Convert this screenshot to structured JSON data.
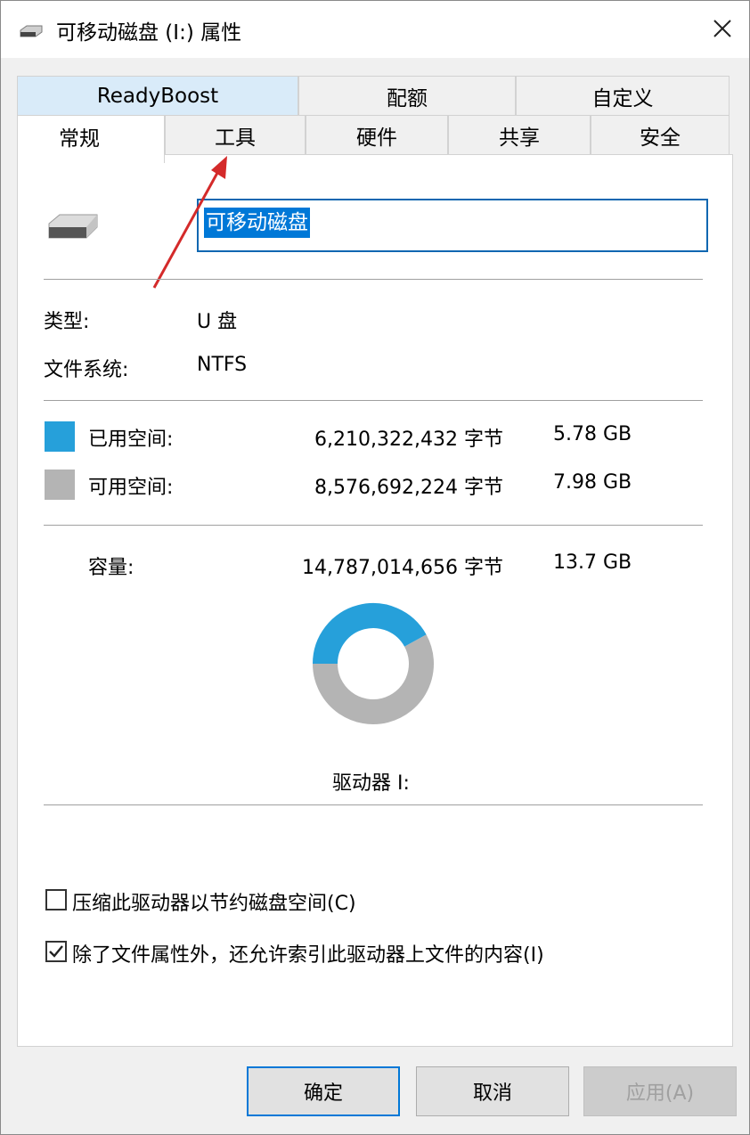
{
  "window": {
    "title": "可移动磁盘 (I:) 属性",
    "close_symbol": "✕"
  },
  "tabs_back": [
    "ReadyBoost",
    "配额",
    "自定义"
  ],
  "tabs_front": [
    "常规",
    "工具",
    "硬件",
    "共享",
    "安全"
  ],
  "active_tab": "常规",
  "general": {
    "name_value": "可移动磁盘",
    "type_label": "类型:",
    "type_value": "U 盘",
    "fs_label": "文件系统:",
    "fs_value": "NTFS",
    "used_label": "已用空间:",
    "used_bytes": "6,210,322,432 字节",
    "used_size": "5.78 GB",
    "free_label": "可用空间:",
    "free_bytes": "8,576,692,224 字节",
    "free_size": "7.98 GB",
    "capacity_label": "容量:",
    "capacity_bytes": "14,787,014,656 字节",
    "capacity_size": "13.7 GB",
    "drive_label": "驱动器 I:",
    "compress_label": "压缩此驱动器以节约磁盘空间(C)",
    "compress_checked": false,
    "index_label": "除了文件属性外，还允许索引此驱动器上文件的内容(I)",
    "index_checked": true
  },
  "usage": {
    "used_fraction": 0.42,
    "used_color": "#26a0da",
    "free_color": "#b4b4b4"
  },
  "buttons": {
    "ok": "确定",
    "cancel": "取消",
    "apply": "应用(A)"
  }
}
